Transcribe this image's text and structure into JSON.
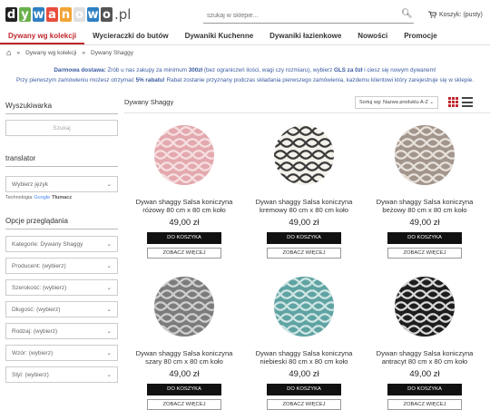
{
  "logo": {
    "letters": [
      "d",
      "y",
      "w",
      "a",
      "n",
      "o",
      "w",
      "o"
    ],
    "colors": [
      "#222",
      "#6ab04c",
      "#2f80c2",
      "#e84c3d",
      "#f1a536",
      "#e0e0e0",
      "#2f80c2",
      "#555"
    ],
    "suffix": ".pl"
  },
  "header": {
    "search_placeholder": "szukaj w sklepie...",
    "cart_label": "Koszyk: (pusty)"
  },
  "nav": {
    "items": [
      "Dywany wg kolekcji",
      "Wycieraczki do butów",
      "Dywaniki Kuchenne",
      "Dywaniki łazienkowe",
      "Nowości",
      "Promocje"
    ]
  },
  "breadcrumb": {
    "items": [
      "Dywany wg kolekcji",
      "Dywany Shaggy"
    ]
  },
  "promo": {
    "line1_a": "Darmowa dostawa:",
    "line1_b": " Zrób u nas zakupy za minimum ",
    "line1_c": "300zł",
    "line1_d": " (bez ograniczeń ilości, wagi czy rozmiaru), wybierz ",
    "line1_e": "GLS za 0zł",
    "line1_f": " i ciesz się nowym dywanem!",
    "line2_a": "Przy pierwszym zamówieniu możesz otrzymać ",
    "line2_b": "5% rabatu!",
    "line2_c": " Rabat zostanie przyznany podczas składania pierwszego zamówienia, każdemu klientowi który zarejestruje się w sklepie."
  },
  "sidebar": {
    "search_title": "Wyszukiwarka",
    "search_placeholder": "Szukaj",
    "translator_title": "translator",
    "language_select": "Wybierz język",
    "tech_label": "Technologia",
    "google_label": "Google",
    "translate_label": "Tłumacz",
    "options_title": "Opcje przeglądania",
    "filters": [
      "Kategorie: Dywany Shaggy",
      "Producent: (wybierz)",
      "Szerokość: (wybierz)",
      "Długość: (wybierz)",
      "Rodzaj: (wybierz)",
      "Wzór: (wybierz)",
      "Styl: (wybierz)"
    ]
  },
  "main": {
    "title": "Dywany Shaggy",
    "sort_label": "Sortuj wg: Nazwa produktu A-Z",
    "add_to_cart": "DO KOSZYKA",
    "see_more": "ZOBACZ WIĘCEJ",
    "products": [
      {
        "title_l1": "Dywan shaggy Salsa koniczyna",
        "title_l2": "różowy 80 cm x 80 cm koło",
        "price": "49,00 zł",
        "base": "#e3a9ae",
        "line": "#f6dfe1"
      },
      {
        "title_l1": "Dywan shaggy Salsa koniczyna",
        "title_l2": "kremowy 80 cm x 80 cm koło",
        "price": "49,00 zł",
        "base": "#f3f1ea",
        "line": "#3a3a3a"
      },
      {
        "title_l1": "Dywan shaggy Salsa koniczyna",
        "title_l2": "beżowy 80 cm x 80 cm koło",
        "price": "49,00 zł",
        "base": "#a2958c",
        "line": "#e8e2dc"
      },
      {
        "title_l1": "Dywan shaggy Salsa koniczyna",
        "title_l2": "szary 80 cm x 80 cm koło",
        "price": "49,00 zł",
        "base": "#7c7c7c",
        "line": "#cfcfcf"
      },
      {
        "title_l1": "Dywan shaggy Salsa koniczyna",
        "title_l2": "niebieski 80 cm x 80 cm koło",
        "price": "49,00 zł",
        "base": "#5fa3a3",
        "line": "#cfe6e4"
      },
      {
        "title_l1": "Dywan shaggy Salsa koniczyna",
        "title_l2": "antracyt 80 cm x 80 cm koło",
        "price": "49,00 zł",
        "base": "#1e1e1e",
        "line": "#d9d9d9"
      }
    ]
  },
  "colors": {
    "accent": "#c0272d",
    "promo": "#3a5ba0"
  }
}
